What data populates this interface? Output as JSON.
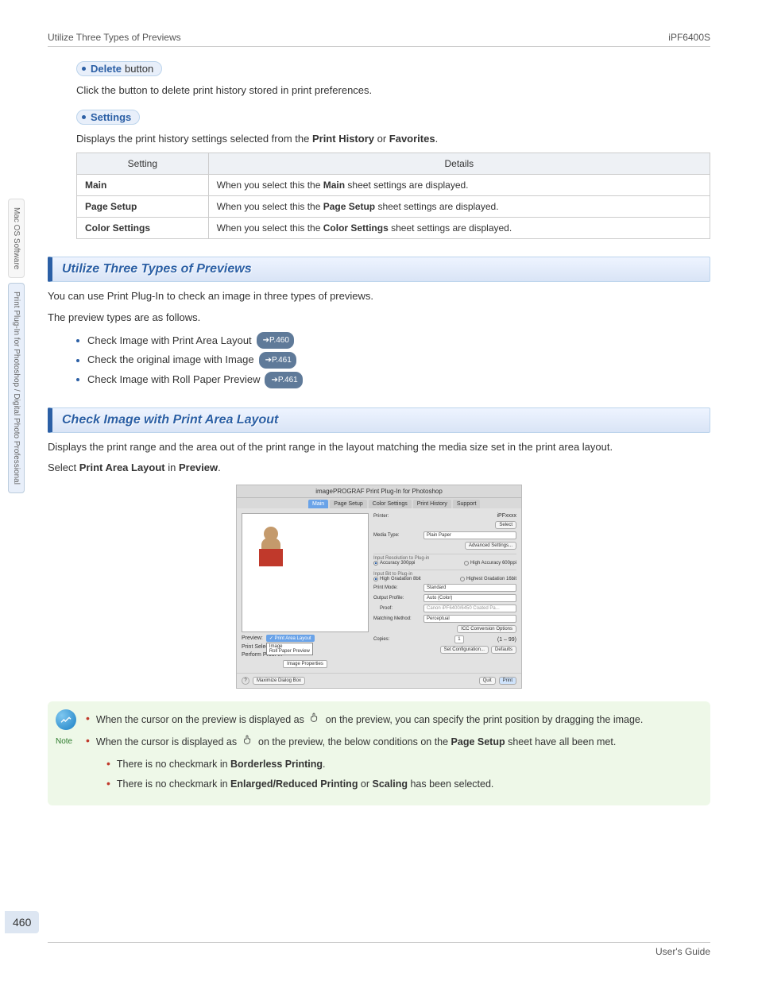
{
  "header": {
    "left": "Utilize Three Types of Previews",
    "right": "iPF6400S"
  },
  "sidebar": {
    "tab1": "Mac OS Software",
    "tab2": "Print Plug-In for Photoshop / Digital Photo Professional"
  },
  "sec_delete": {
    "label_bold": "Delete",
    "label_plain": "button",
    "desc": "Click the button to delete print history stored in print preferences."
  },
  "sec_settings": {
    "label_bold": "Settings",
    "desc_pre": "Displays the print history settings selected from the ",
    "desc_b1": "Print History",
    "desc_mid": " or ",
    "desc_b2": "Favorites",
    "desc_post": "."
  },
  "table": {
    "h1": "Setting",
    "h2": "Details",
    "rows": [
      {
        "c1": "Main",
        "c2a": "When you select this the ",
        "c2b": "Main",
        "c2c": " sheet settings are displayed."
      },
      {
        "c1": "Page Setup",
        "c2a": "When you select this the ",
        "c2b": "Page Setup",
        "c2c": " sheet settings are displayed."
      },
      {
        "c1": "Color Settings",
        "c2a": "When you select this the ",
        "c2b": "Color Settings",
        "c2c": " sheet settings are displayed."
      }
    ]
  },
  "s1": {
    "title": "Utilize Three Types of Previews",
    "p1": "You can use Print Plug-In to check an image in three types of previews.",
    "p2": "The preview types are as follows.",
    "items": [
      {
        "t": "Check Image with Print Area Layout",
        "pill": "➔P.460"
      },
      {
        "t": "Check the original image with Image",
        "pill": "➔P.461"
      },
      {
        "t": "Check Image with Roll Paper Preview",
        "pill": "➔P.461"
      }
    ]
  },
  "s2": {
    "title": "Check Image with Print Area Layout",
    "p1": "Displays the print range and the area out of the print range in the layout matching the media size set in the print area layout.",
    "p2a": "Select ",
    "p2b": "Print Area Layout",
    "p2c": " in ",
    "p2d": "Preview",
    "p2e": "."
  },
  "shot": {
    "title": "imagePROGRAF Print Plug-In for Photoshop",
    "tabs": [
      "Main",
      "Page Setup",
      "Color Settings",
      "Print History",
      "Support"
    ],
    "preview_lbl": "Preview:",
    "dd_sel": "✓ Print Area Layout",
    "dd_o1": "Image",
    "dd_o2": "Roll Paper Preview",
    "cb1": "Print Selected Bo",
    "cb2": "Perform Proof in",
    "btn_imgprop": "Image Properties",
    "btn_max": "Maximize Dialog Box",
    "r_printer_l": "Printer:",
    "r_printer_v": "iPFxxxx",
    "r_select": "Select",
    "r_media_l": "Media Type:",
    "r_media_v": "Plain Paper",
    "r_adv": "Advanced Settings...",
    "r_res_t": "Input Resolution to Plug-in",
    "r_res1": "Accuracy 300ppi",
    "r_res2": "High Accuracy 600ppi",
    "r_bit_t": "Input Bit to Plug-in",
    "r_bit1": "High Gradation 8bit",
    "r_bit2": "Highest Gradation 16bit",
    "r_pm_l": "Print Mode:",
    "r_pm_v": "Standard",
    "r_op_l": "Output Profile:",
    "r_op_v": "Auto (Color)",
    "r_pf_l": "Proof:",
    "r_pf_v": "Canon iPF6400/6450 Coated Pa...",
    "r_mm_l": "Matching Method:",
    "r_mm_v": "Perceptual",
    "r_icc": "ICC Conversion Options",
    "r_cp_l": "Copies:",
    "r_cp_v": "1",
    "r_cp_r": "(1 – 99)",
    "r_setconf": "Set Configuration...",
    "r_def": "Defaults",
    "f_quit": "Quit",
    "f_print": "Print"
  },
  "note": {
    "label": "Note",
    "l1a": "When the cursor on the preview is displayed as ",
    "l1b": " on the preview, you can specify the print position by dragging the image.",
    "l2a": "When the cursor is displayed as ",
    "l2b": " on the preview, the below conditions on the ",
    "l2c": "Page Setup",
    "l2d": " sheet have all been met.",
    "s1a": "There is no checkmark in ",
    "s1b": "Borderless Printing",
    "s1c": ".",
    "s2a": "There is no checkmark in ",
    "s2b": "Enlarged/Reduced Printing",
    "s2c": " or ",
    "s2d": "Scaling",
    "s2e": " has been selected."
  },
  "pagenum": "460",
  "footer": "User's Guide"
}
